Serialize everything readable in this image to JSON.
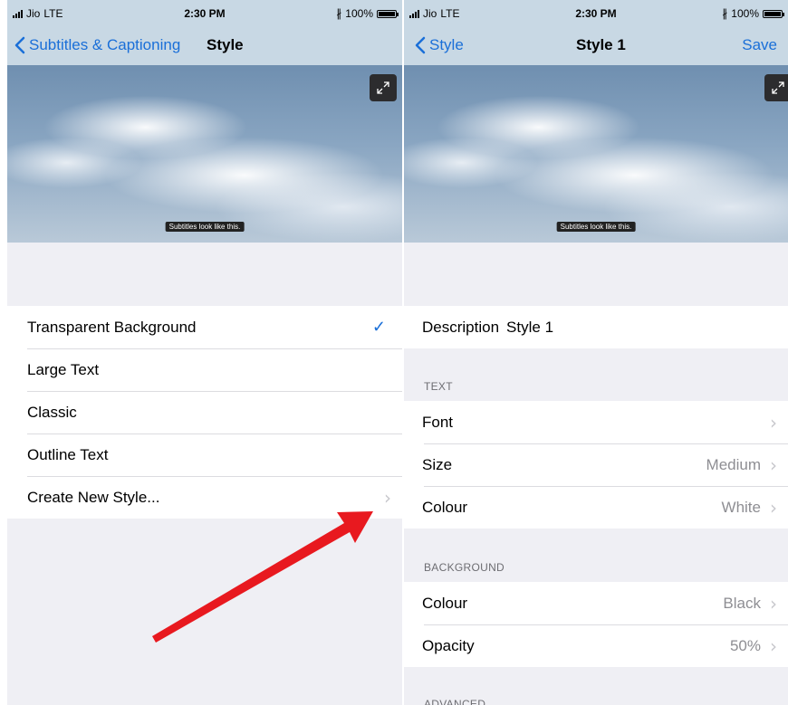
{
  "left_screen": {
    "status": {
      "carrier": "Jio",
      "network": "LTE",
      "time": "2:30 PM",
      "battery_pct": "100%"
    },
    "nav": {
      "back_label": "Subtitles & Captioning",
      "title": "Style"
    },
    "preview": {
      "subtitle_text": "Subtitles look like this."
    },
    "styles": [
      {
        "label": "Transparent Background",
        "selected": true
      },
      {
        "label": "Large Text"
      },
      {
        "label": "Classic"
      },
      {
        "label": "Outline Text"
      },
      {
        "label": "Create New Style..."
      }
    ]
  },
  "right_screen": {
    "status": {
      "carrier": "Jio",
      "network": "LTE",
      "time": "2:30 PM",
      "battery_pct": "100%"
    },
    "nav": {
      "back_label": "Style",
      "title": "Style 1",
      "save_label": "Save"
    },
    "preview": {
      "subtitle_text": "Subtitles look like this."
    },
    "description": {
      "label": "Description",
      "value": "Style 1"
    },
    "text_section": {
      "header": "TEXT",
      "rows": [
        {
          "label": "Font",
          "value": ""
        },
        {
          "label": "Size",
          "value": "Medium"
        },
        {
          "label": "Colour",
          "value": "White"
        }
      ]
    },
    "background_section": {
      "header": "BACKGROUND",
      "rows": [
        {
          "label": "Colour",
          "value": "Black"
        },
        {
          "label": "Opacity",
          "value": "50%"
        }
      ]
    },
    "advanced_header": "ADVANCED"
  },
  "colors": {
    "accent": "#1a6fd8",
    "arrow": "#e8191f",
    "nav_bg": "#c8d8e4",
    "group_bg": "#efeff4"
  },
  "icons": {
    "back": "chevron-left-icon",
    "disclosure": "chevron-right-icon",
    "check": "checkmark-icon",
    "expand": "expand-icon"
  }
}
